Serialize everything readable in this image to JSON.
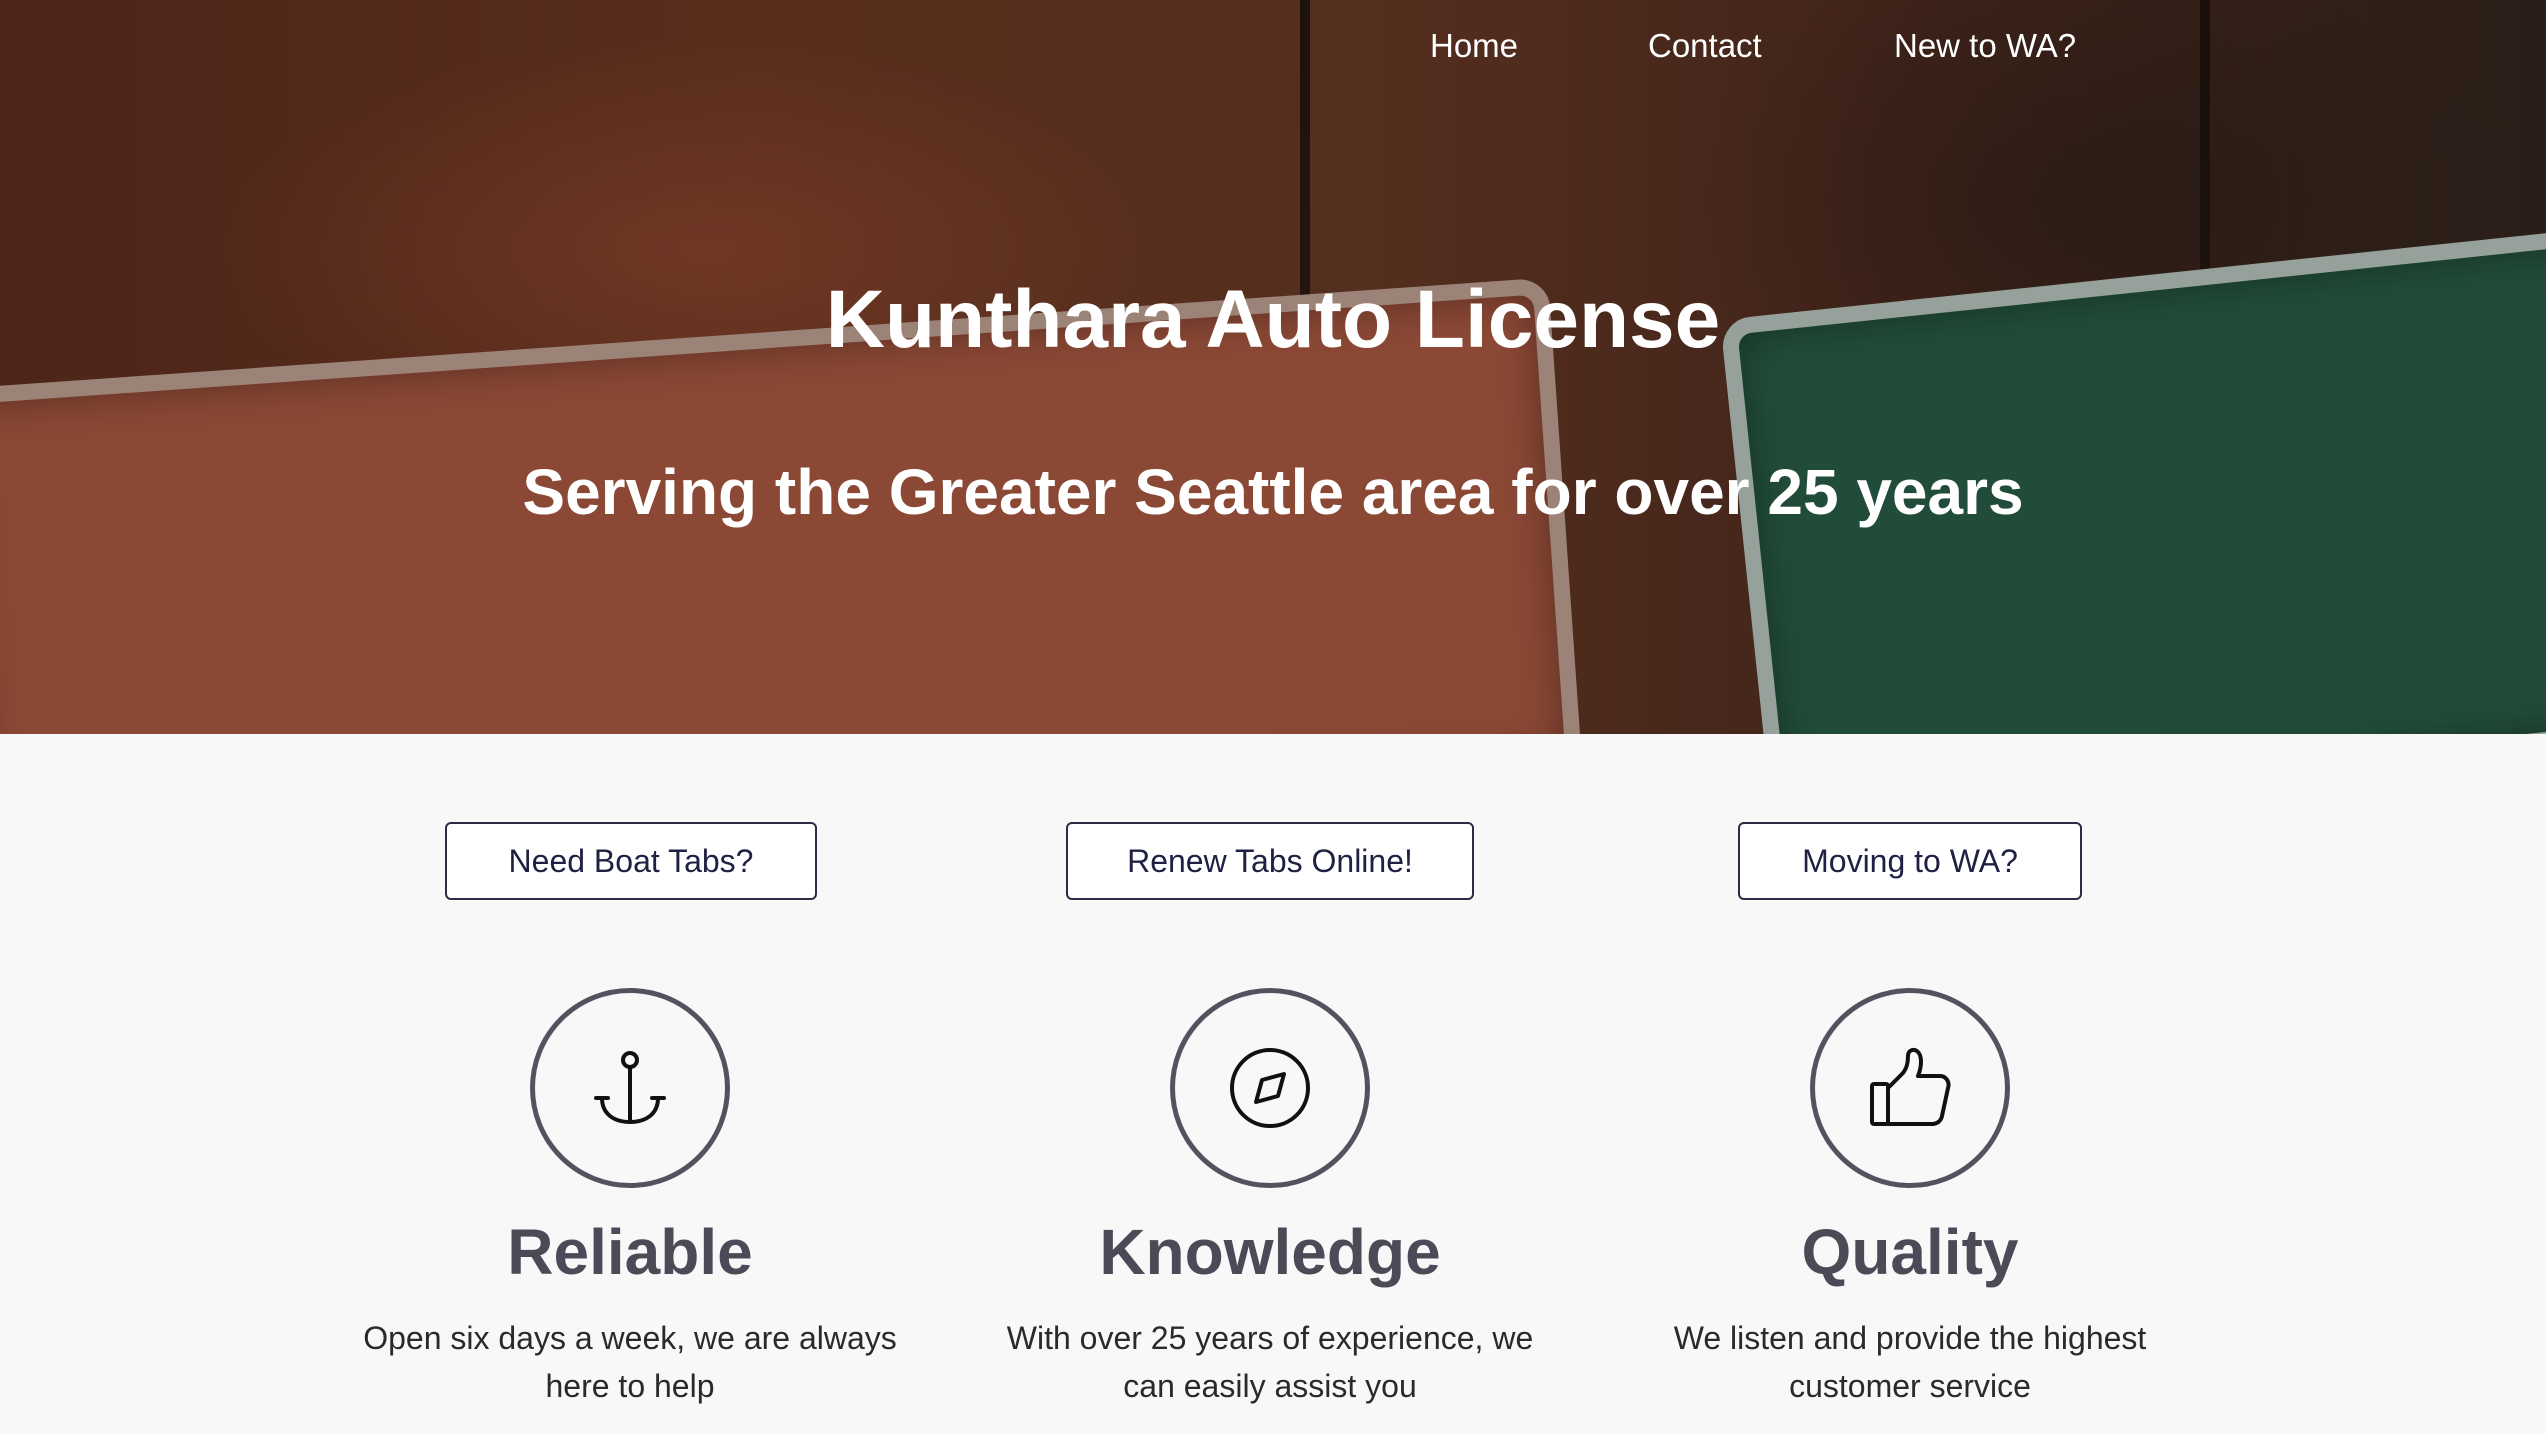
{
  "nav": {
    "items": [
      {
        "label": "Home"
      },
      {
        "label": "Contact"
      },
      {
        "label": "New to WA?"
      }
    ]
  },
  "hero": {
    "title": "Kunthara Auto License",
    "subtitle": "Serving the Greater Seattle area for over 25 years"
  },
  "actions": [
    {
      "label": "Need Boat Tabs?"
    },
    {
      "label": "Renew Tabs Online!"
    },
    {
      "label": "Moving to WA?"
    }
  ],
  "features": [
    {
      "icon": "anchor-icon",
      "title": "Reliable",
      "description": "Open six days a week, we are always here to help"
    },
    {
      "icon": "compass-icon",
      "title": "Knowledge",
      "description": "With over 25 years of experience, we can easily assist you"
    },
    {
      "icon": "thumbs-up-icon",
      "title": "Quality",
      "description": "We listen and provide the highest customer service"
    }
  ],
  "colors": {
    "button_border": "#2b2d45",
    "button_text": "#1f2143",
    "icon_ring": "#53525f",
    "feature_title": "#4b4b58",
    "page_background": "#f8f8f8"
  }
}
